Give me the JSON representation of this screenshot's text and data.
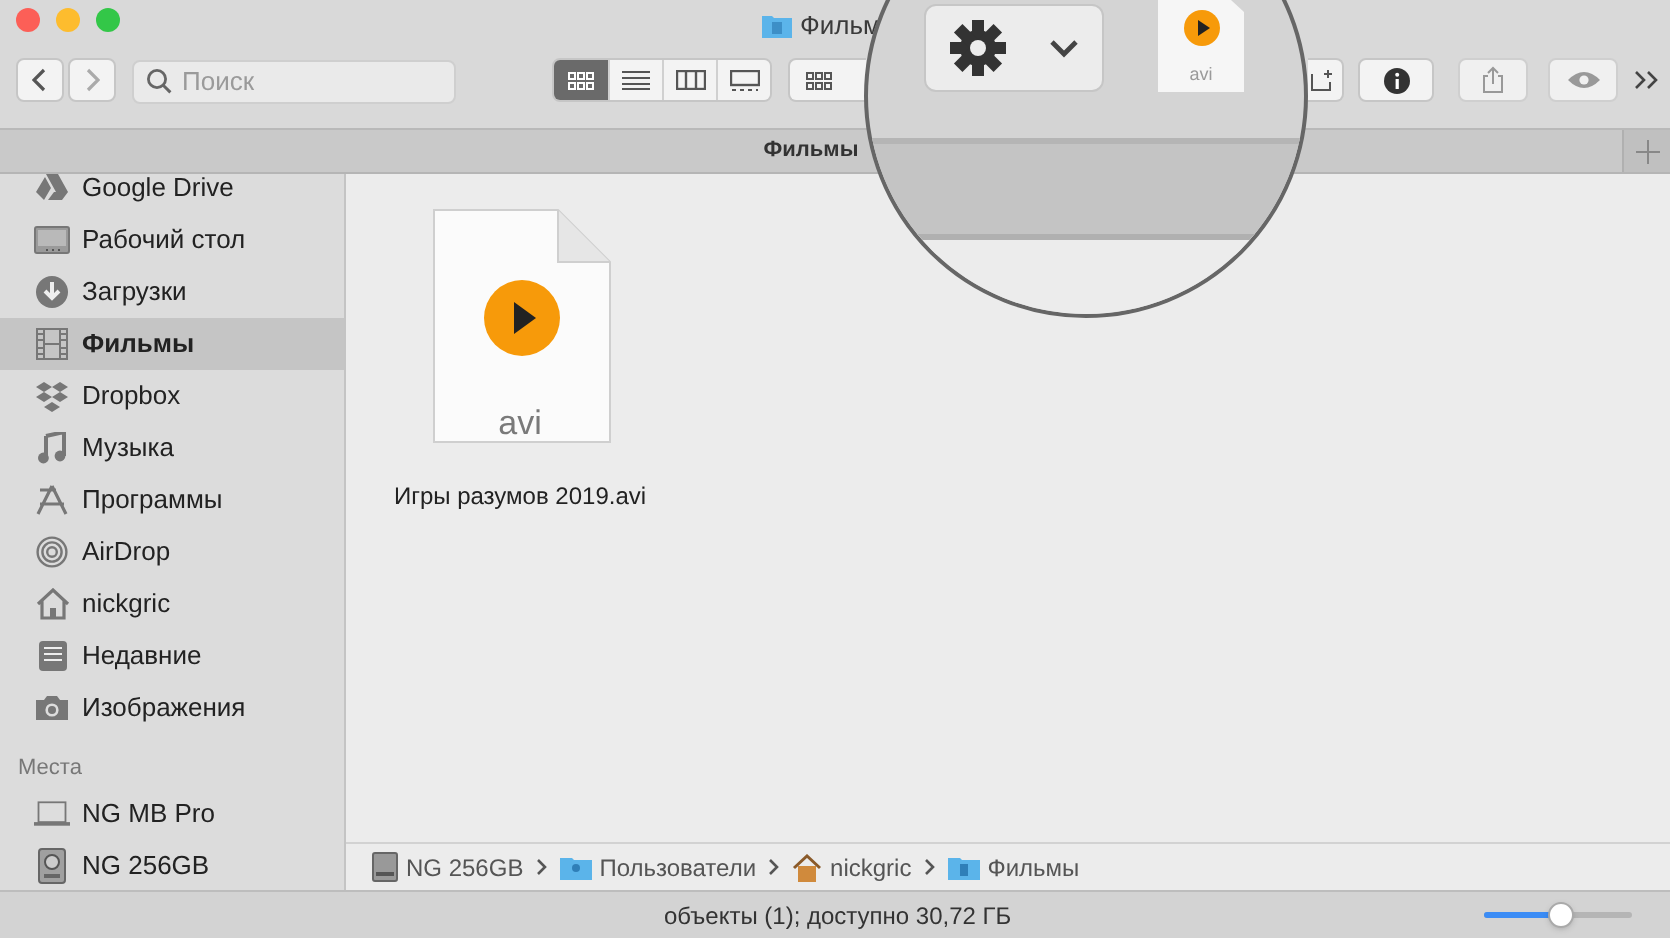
{
  "window": {
    "title": "Фильм"
  },
  "toolbar": {
    "search": {
      "placeholder": "Поиск"
    },
    "view_modes": [
      {
        "selected": true
      },
      {
        "selected": false
      },
      {
        "selected": false
      },
      {
        "selected": false
      }
    ]
  },
  "tab": {
    "label": "Фильмы"
  },
  "sidebar": {
    "items": [
      {
        "label": "Google Drive",
        "selected": false
      },
      {
        "label": "Рабочий стол",
        "selected": false
      },
      {
        "label": "Загрузки",
        "selected": false
      },
      {
        "label": "Фильмы",
        "selected": true
      },
      {
        "label": "Dropbox",
        "selected": false
      },
      {
        "label": "Музыка",
        "selected": false
      },
      {
        "label": "Программы",
        "selected": false
      },
      {
        "label": "AirDrop",
        "selected": false
      },
      {
        "label": "nickgric",
        "selected": false
      },
      {
        "label": "Недавние",
        "selected": false
      },
      {
        "label": "Изображения",
        "selected": false
      }
    ],
    "places": {
      "header": "Места",
      "items": [
        {
          "label": "NG MB Pro",
          "selected": false
        },
        {
          "label": "NG 256GB",
          "selected": false
        }
      ]
    }
  },
  "files": [
    {
      "name": "Игры разумов 2019.avi",
      "type_label": "avi"
    }
  ],
  "magnifier": {
    "file_label": "avi"
  },
  "path_bar": [
    "NG 256GB",
    "Пользователи",
    "nickgric",
    "Фильмы"
  ],
  "status_bar": {
    "text": "объекты (1); доступно 30,72 ГБ",
    "zoom": {
      "level": 0.52
    }
  }
}
